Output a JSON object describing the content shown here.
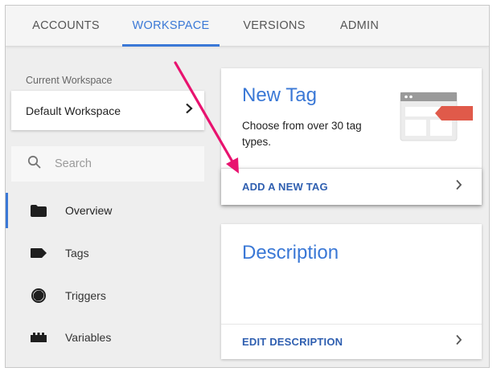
{
  "nav": {
    "tabs": [
      {
        "label": "ACCOUNTS"
      },
      {
        "label": "WORKSPACE"
      },
      {
        "label": "VERSIONS"
      },
      {
        "label": "ADMIN"
      }
    ]
  },
  "sidebar": {
    "workspace_label": "Current Workspace",
    "workspace_name": "Default Workspace",
    "search_placeholder": "Search",
    "items": [
      {
        "label": "Overview",
        "icon": "folder-icon"
      },
      {
        "label": "Tags",
        "icon": "tag-icon"
      },
      {
        "label": "Triggers",
        "icon": "trigger-icon"
      },
      {
        "label": "Variables",
        "icon": "variables-icon"
      }
    ]
  },
  "new_tag_card": {
    "title": "New Tag",
    "text": "Choose from over 30 tag types.",
    "action_label": "ADD A NEW TAG"
  },
  "description_card": {
    "title": "Description",
    "action_label": "EDIT DESCRIPTION"
  },
  "colors": {
    "accent": "#3a78d6",
    "action_text": "#2f5fb0",
    "annotation_arrow": "#e8136f",
    "tag_red": "#e05a4a"
  }
}
